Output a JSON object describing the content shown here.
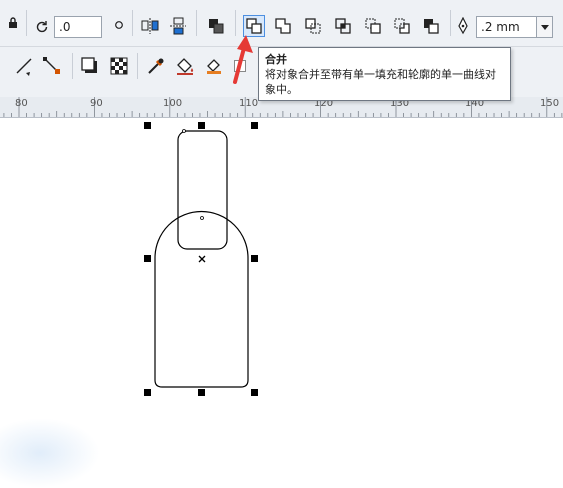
{
  "toolbar": {
    "rotation_value": ".0",
    "outline_width_value": ".2 mm",
    "icons_row1": [
      "lock-icon",
      "rotate-icon",
      "degree-icon",
      "mirror-horizontal-icon",
      "mirror-vertical-icon",
      "arrange-icon",
      "combine-icon",
      "weld-icon",
      "trim-icon",
      "intersect-icon",
      "simplify-icon",
      "front-minus-back-icon",
      "back-minus-front-icon",
      "outline-pen-icon"
    ],
    "icons_row2": [
      "line-tool-icon",
      "connector-tool-icon",
      "drop-shadow-icon",
      "transparency-icon",
      "eyedropper-icon",
      "fill-icon",
      "smart-fill-icon"
    ]
  },
  "tooltip": {
    "title": "合并",
    "description": "将对象合并至带有单一填充和轮廓的单一曲线对象中。"
  },
  "ruler": {
    "labels": [
      "80",
      "90",
      "100",
      "110",
      "120",
      "130",
      "140",
      "150"
    ]
  },
  "colors": {
    "toolbar_bg": "#eef1f5",
    "active_button": "#d8e8fb",
    "annotation_arrow": "#e53935"
  }
}
